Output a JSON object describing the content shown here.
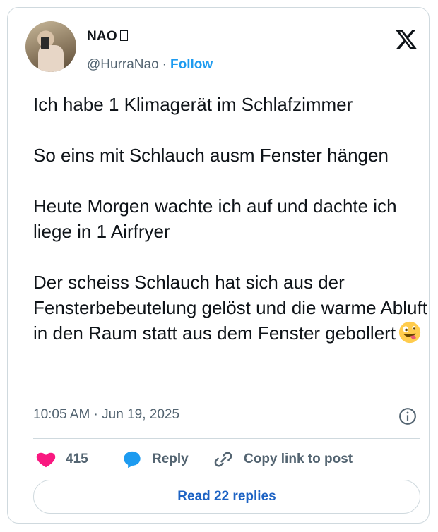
{
  "author": {
    "name": "NAO",
    "handle": "@HurraNao",
    "separator": "·",
    "follow_label": "Follow"
  },
  "tweet": {
    "text": "Ich habe 1 Klimagerät im Schlafzimmer\n\nSo eins mit Schlauch ausm Fenster hängen\n\nHeute Morgen wachte ich auf und dachte ich liege in 1 Airfryer\n\nDer scheiss Schlauch hat sich aus der Fensterbebeutelung gelöst und die warme Abluft in den Raum statt aus dem Fenster gebollert",
    "emoji_icon": "zany-face-emoji",
    "timestamp": "10:05 AM · Jun 19, 2025"
  },
  "actions": {
    "like_count": "415",
    "reply_label": "Reply",
    "copy_label": "Copy link to post"
  },
  "read_replies_label": "Read 22 replies",
  "colors": {
    "accent": "#1d9bf0",
    "heart": "#f91880",
    "reply_bubble": "#1d9bf0",
    "muted": "#536471",
    "border": "#cfd9de"
  }
}
